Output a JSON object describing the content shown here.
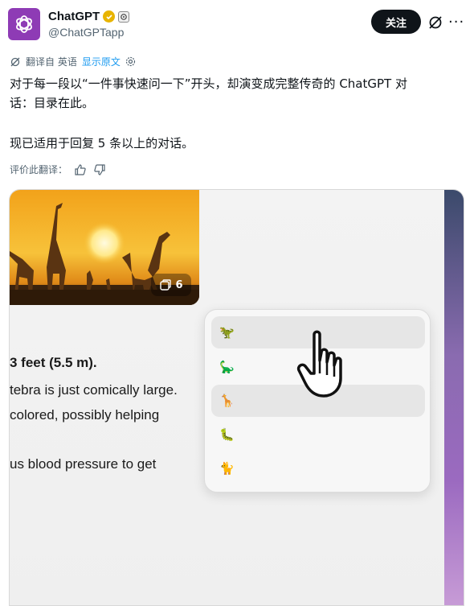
{
  "header": {
    "name": "ChatGPT",
    "handle": "@ChatGPTapp",
    "follow_label": "关注",
    "more_label": "···"
  },
  "translation": {
    "translated_from": "翻译自 英语",
    "show_original": "显示原文"
  },
  "tweet": {
    "line1": "对于每一段以“一件事快速问一下”开头，却演变成完整传奇的 ChatGPT 对",
    "line2": "话：目录在此。",
    "line3": "现已适用于回复 5 条以上的对话。"
  },
  "rate": {
    "label": "评价此翻译："
  },
  "media": {
    "photo_count": "6",
    "chat_lines": [
      "3 feet (5.5 m).",
      "tebra is just comically large.",
      " colored, possibly helping",
      "us blood pressure to get"
    ],
    "popup_items": [
      "🦖",
      "🦕",
      "🦒",
      "🐛",
      "🐈"
    ]
  },
  "colors": {
    "avatar_bg": "#8e3bb5",
    "link": "#1d9bf0",
    "follow_bg": "#0f1419",
    "verified": "#e8b400"
  }
}
